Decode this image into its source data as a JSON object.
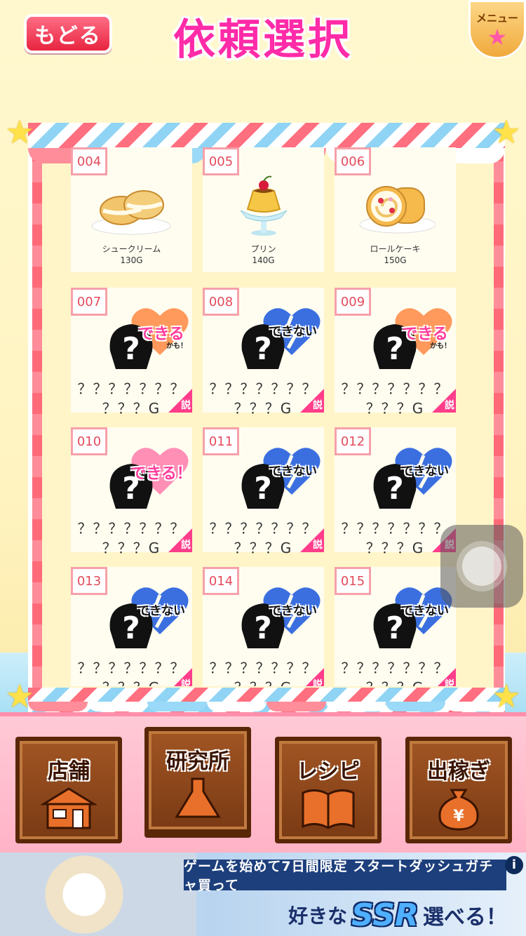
{
  "header": {
    "back_label": "もどる",
    "title": "依頼選択",
    "menu_label": "メニュー",
    "menu_icon": "star-icon"
  },
  "requests": [
    {
      "id": "004",
      "name": "シュークリーム",
      "price": "130G",
      "unlocked": true,
      "image": "cream-puff-icon"
    },
    {
      "id": "005",
      "name": "プリン",
      "price": "140G",
      "unlocked": true,
      "image": "pudding-icon"
    },
    {
      "id": "006",
      "name": "ロールケーキ",
      "price": "150G",
      "unlocked": true,
      "image": "roll-cake-icon"
    },
    {
      "id": "007",
      "name": "？？？？？？？",
      "price": "？？？G",
      "unlocked": false,
      "status": "できる",
      "status_sub": "かも！",
      "heart_color": "#ff9a5c",
      "help": "説"
    },
    {
      "id": "008",
      "name": "？？？？？？？",
      "price": "？？？G",
      "unlocked": false,
      "status": "できない",
      "status_sub": "",
      "heart_color": "#3b6fe0",
      "help": "説"
    },
    {
      "id": "009",
      "name": "？？？？？？？",
      "price": "？？？G",
      "unlocked": false,
      "status": "できる",
      "status_sub": "かも！",
      "heart_color": "#ff9a5c",
      "help": "説"
    },
    {
      "id": "010",
      "name": "？？？？？？？",
      "price": "？？？G",
      "unlocked": false,
      "status": "できる！",
      "status_sub": "",
      "heart_color": "#ff8fb5",
      "help": "説"
    },
    {
      "id": "011",
      "name": "？？？？？？？",
      "price": "？？？G",
      "unlocked": false,
      "status": "できない",
      "status_sub": "",
      "heart_color": "#3b6fe0",
      "help": "説"
    },
    {
      "id": "012",
      "name": "？？？？？？？",
      "price": "？？？G",
      "unlocked": false,
      "status": "できない",
      "status_sub": "",
      "heart_color": "#3b6fe0",
      "help": "説"
    },
    {
      "id": "013",
      "name": "？？？？？？？",
      "price": "？？？G",
      "unlocked": false,
      "status": "できない",
      "status_sub": "",
      "heart_color": "#3b6fe0",
      "help": "説"
    },
    {
      "id": "014",
      "name": "？？？？？？？",
      "price": "？？？G",
      "unlocked": false,
      "status": "できない",
      "status_sub": "",
      "heart_color": "#3b6fe0",
      "help": "説"
    },
    {
      "id": "015",
      "name": "？？？？？？？",
      "price": "？？？G",
      "unlocked": false,
      "status": "できない",
      "status_sub": "",
      "heart_color": "#3b6fe0",
      "help": "説"
    }
  ],
  "nav": [
    {
      "label": "店舗",
      "icon": "shop-icon",
      "active": false
    },
    {
      "label": "研究所",
      "icon": "flask-icon",
      "active": true
    },
    {
      "label": "レシピ",
      "icon": "recipe-book-icon",
      "active": false
    },
    {
      "label": "出稼ぎ",
      "icon": "money-bag-icon",
      "active": false
    }
  ],
  "banner": {
    "top_text": "ゲームを始めて7日間限定 スタートダッシュガチャ買って",
    "pre": "好きな",
    "ssr": "SSR",
    "post": "選べる！",
    "info": "i"
  },
  "colors": {
    "title": "#ff2ba8",
    "back_button": "#e8243f",
    "can_heart": "#ff9a5c",
    "cannot_heart": "#3b6fe0"
  }
}
